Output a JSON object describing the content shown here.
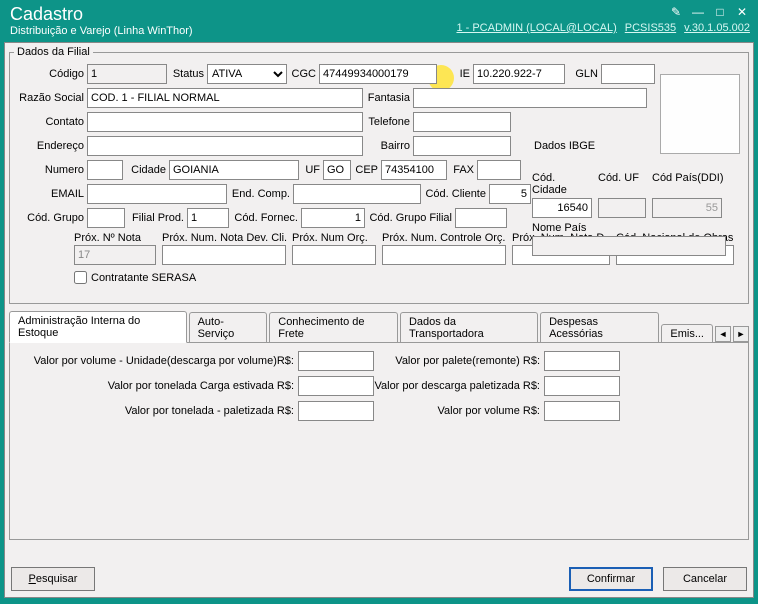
{
  "titlebar": {
    "title": "Cadastro",
    "subtitle": "Distribuição e Varejo (Linha WinThor)",
    "user": "1 - PCADMIN (LOCAL@LOCAL)",
    "module": "PCSIS535",
    "version": "v.30.1.05.002"
  },
  "fieldset_legend": "Dados da Filial",
  "labels": {
    "codigo": "Código",
    "status": "Status",
    "cgc": "CGC",
    "ie": "IE",
    "gln": "GLN",
    "razao": "Razão Social",
    "fantasia": "Fantasia",
    "contato": "Contato",
    "telefone": "Telefone",
    "endereco": "Endereço",
    "bairro": "Bairro",
    "numero": "Numero",
    "cidade": "Cidade",
    "uf": "UF",
    "cep": "CEP",
    "fax": "FAX",
    "email": "EMAIL",
    "endcomp": "End. Comp.",
    "codcliente": "Cód. Cliente",
    "codgrupo": "Cód. Grupo",
    "filialprod": "Filial Prod.",
    "codfornec": "Cód. Fornec.",
    "codgrupofilial": "Cód. Grupo Filial",
    "proxnota": "Próx. Nº Nota",
    "proxnotadev": "Próx. Num. Nota Dev. Cli.",
    "proxnumorc": "Próx. Num Orç.",
    "proxnumctrlorc": "Próx. Num. Controle Orç.",
    "proxnumnotad": "Próx. Num. Nota D.",
    "codnacobras": "Cód. Nacional de Obras",
    "contratante": "Contratante SERASA",
    "ibge": "Dados IBGE",
    "codcidade": "Cód. Cidade",
    "coduf": "Cód. UF",
    "codpais": "Cód País(DDI)",
    "nomepais": "Nome País"
  },
  "values": {
    "codigo": "1",
    "status": "ATIVA",
    "cgc": "47449934000179",
    "ie": "10.220.922-7",
    "gln": "",
    "razao": "COD. 1 - FILIAL NORMAL",
    "fantasia": "",
    "contato": "",
    "telefone": "",
    "endereco": "",
    "bairro": "",
    "numero": "",
    "cidade": "GOIANIA",
    "uf": "GO",
    "cep": "74354100",
    "fax": "",
    "email": "",
    "endcomp": "",
    "codcliente": "5",
    "codgrupo": "",
    "filialprod": "1",
    "codfornec": "1",
    "codgrupofilial": "",
    "proxnota": "17",
    "proxnotadev": "",
    "proxnumorc": "",
    "proxnumctrlorc": "",
    "proxnumnotad": "",
    "codnacobras": "",
    "codcidade": "16540",
    "coduf": "",
    "codpais": "55",
    "nomepais": ""
  },
  "tabs": {
    "t1": "Administração Interna do Estoque",
    "t2": "Auto-Serviço",
    "t3": "Conhecimento de Frete",
    "t4": "Dados da Transportadora",
    "t5": "Despesas Acessórias",
    "t6": "Emis..."
  },
  "tablabels": {
    "l1": "Valor por volume - Unidade(descarga por volume)R$:",
    "l2": "Valor por tonelada Carga estivada R$:",
    "l3": "Valor por tonelada - paletizada R$:",
    "r1": "Valor por palete(remonte) R$:",
    "r2": "Valor por descarga paletizada R$:",
    "r3": "Valor por volume R$:"
  },
  "buttons": {
    "pesquisar": "Pesquisar",
    "confirmar": "Confirmar",
    "cancelar": "Cancelar"
  }
}
